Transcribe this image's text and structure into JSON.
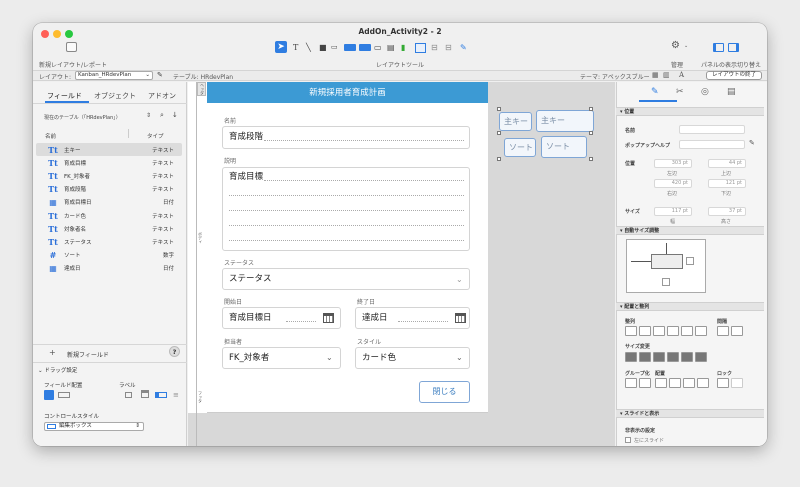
{
  "window": {
    "title": "AddOn_Activity2 - 2"
  },
  "toolbar": {
    "new_layout": "新規レイアウト/レポート",
    "layout_tools": "レイアウトツール",
    "manage": "管理",
    "panel_toggle": "パネルの表示切り替え"
  },
  "layoutbar": {
    "layout_label": "レイアウト:",
    "layout_value": "Kanban_HRdevPlan",
    "table_label": "テーブル: HRdevPlan",
    "theme_label": "テーマ: アペックスブルー",
    "exit_button": "レイアウトの終了"
  },
  "sidebar": {
    "tabs": [
      "フィールド",
      "オブジェクト",
      "アドオン"
    ],
    "current_table": "現在のテーブル（「HRdevPlan」）",
    "col_name": "名前",
    "col_type": "タイプ",
    "fields": [
      {
        "icon": "Tt",
        "name": "主キー",
        "type": "テキスト"
      },
      {
        "icon": "Tt",
        "name": "育成目標",
        "type": "テキスト"
      },
      {
        "icon": "Tt",
        "name": "FK_対象者",
        "type": "テキスト"
      },
      {
        "icon": "Tt",
        "name": "育成段階",
        "type": "テキスト"
      },
      {
        "icon": "▦",
        "name": "育成目標日",
        "type": "日付"
      },
      {
        "icon": "Tt",
        "name": "カード色",
        "type": "テキスト"
      },
      {
        "icon": "Tt",
        "name": "対象者名",
        "type": "テキスト"
      },
      {
        "icon": "Tt",
        "name": "ステータス",
        "type": "テキスト"
      },
      {
        "icon": "#",
        "name": "ソート",
        "type": "数字"
      },
      {
        "icon": "▦",
        "name": "達成日",
        "type": "日付"
      }
    ],
    "new_field": "新規フィールド",
    "help": "?",
    "drag_settings": "ドラッグ設定",
    "field_placement": "フィールド配置",
    "label": "ラベル",
    "control_style": "コントロールスタイル",
    "control_value": "編集ボックス"
  },
  "parts": {
    "header": "ヘッダ",
    "body": "ボディ",
    "footer": "フッタ"
  },
  "form": {
    "title": "新規採用者育成計画",
    "name_label": "名前",
    "name_value": "育成段階",
    "desc_label": "説明",
    "desc_value": "育成目標",
    "status_label": "ステータス",
    "status_value": "ステータス",
    "start_label": "開始日",
    "start_value": "育成目標日",
    "end_label": "終了日",
    "end_value": "達成日",
    "owner_label": "担当者",
    "owner_value": "FK_対象者",
    "style_label": "スタイル",
    "style_value": "カード色",
    "close_button": "閉じる"
  },
  "canvas": {
    "key_label": "主キー",
    "key_field": "主キー",
    "sort_label": "ソート",
    "sort_field": "ソート"
  },
  "inspector": {
    "section_position": "位置",
    "name_label": "名前",
    "popup_help": "ポップアップヘルプ",
    "position_label": "位置",
    "left_value": "303 pt",
    "top_value": "44 pt",
    "left_label": "左辺",
    "top_label": "上辺",
    "right_value": "420 pt",
    "bottom_value": "121 pt",
    "right_label": "右辺",
    "bottom_label": "下辺",
    "size_label": "サイズ",
    "width_value": "117 pt",
    "height_value": "37 pt",
    "width_label": "幅",
    "height_label": "高さ",
    "section_autosize": "自動サイズ調整",
    "section_arrange": "配置と整列",
    "align_label": "整列",
    "spacing_label": "間隔",
    "resize_label": "サイズ変更",
    "group_label": "グループ化",
    "arrange_label": "配置",
    "lock_label": "ロック",
    "section_slide": "スライドと表示",
    "hide_label": "非表示の設定",
    "slide_label": "左にスライド"
  }
}
